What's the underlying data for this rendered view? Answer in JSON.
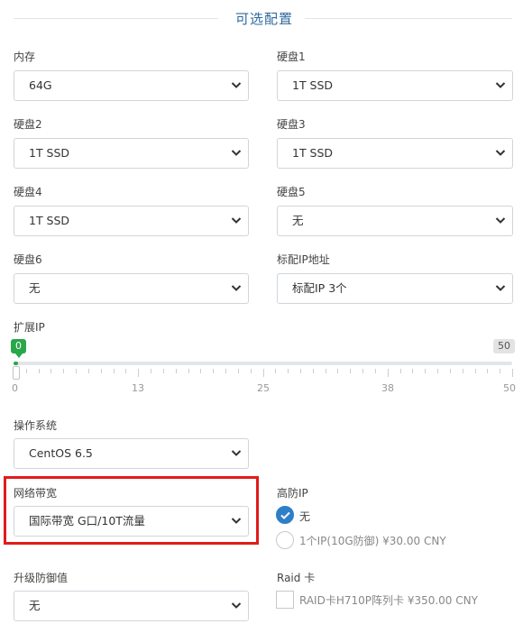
{
  "section": {
    "title": "可选配置"
  },
  "fields": {
    "memory": {
      "label": "内存",
      "value": "64G"
    },
    "disk1": {
      "label": "硬盘1",
      "value": "1T SSD"
    },
    "disk2": {
      "label": "硬盘2",
      "value": "1T SSD"
    },
    "disk3": {
      "label": "硬盘3",
      "value": "1T SSD"
    },
    "disk4": {
      "label": "硬盘4",
      "value": "1T SSD"
    },
    "disk5": {
      "label": "硬盘5",
      "value": "无"
    },
    "disk6": {
      "label": "硬盘6",
      "value": "无"
    },
    "ip": {
      "label": "标配IP地址",
      "value": "标配IP 3个"
    },
    "os": {
      "label": "操作系统",
      "value": "CentOS 6.5"
    },
    "bandwidth": {
      "label": "网络带宽",
      "value": "国际带宽 G口/10T流量"
    },
    "defense": {
      "label": "升级防御值",
      "value": "无"
    }
  },
  "extra_ip": {
    "label": "扩展IP",
    "min": "0",
    "max": "50",
    "current_value": 0,
    "ticks": [
      "0",
      "13",
      "25",
      "38",
      "50"
    ]
  },
  "anti_ddos": {
    "label": "高防IP",
    "options": [
      {
        "text": "无",
        "selected": true
      },
      {
        "text": "1个IP(10G防御) ¥30.00 CNY",
        "selected": false
      }
    ]
  },
  "raid": {
    "label": "Raid 卡",
    "option": "RAID卡H710P阵列卡 ¥350.00 CNY",
    "checked": false
  },
  "colors": {
    "accent": "#2e7fc8",
    "slider_fill": "#2aa64b",
    "highlight_box": "#e21b1b",
    "title": "#2e6a9e"
  }
}
